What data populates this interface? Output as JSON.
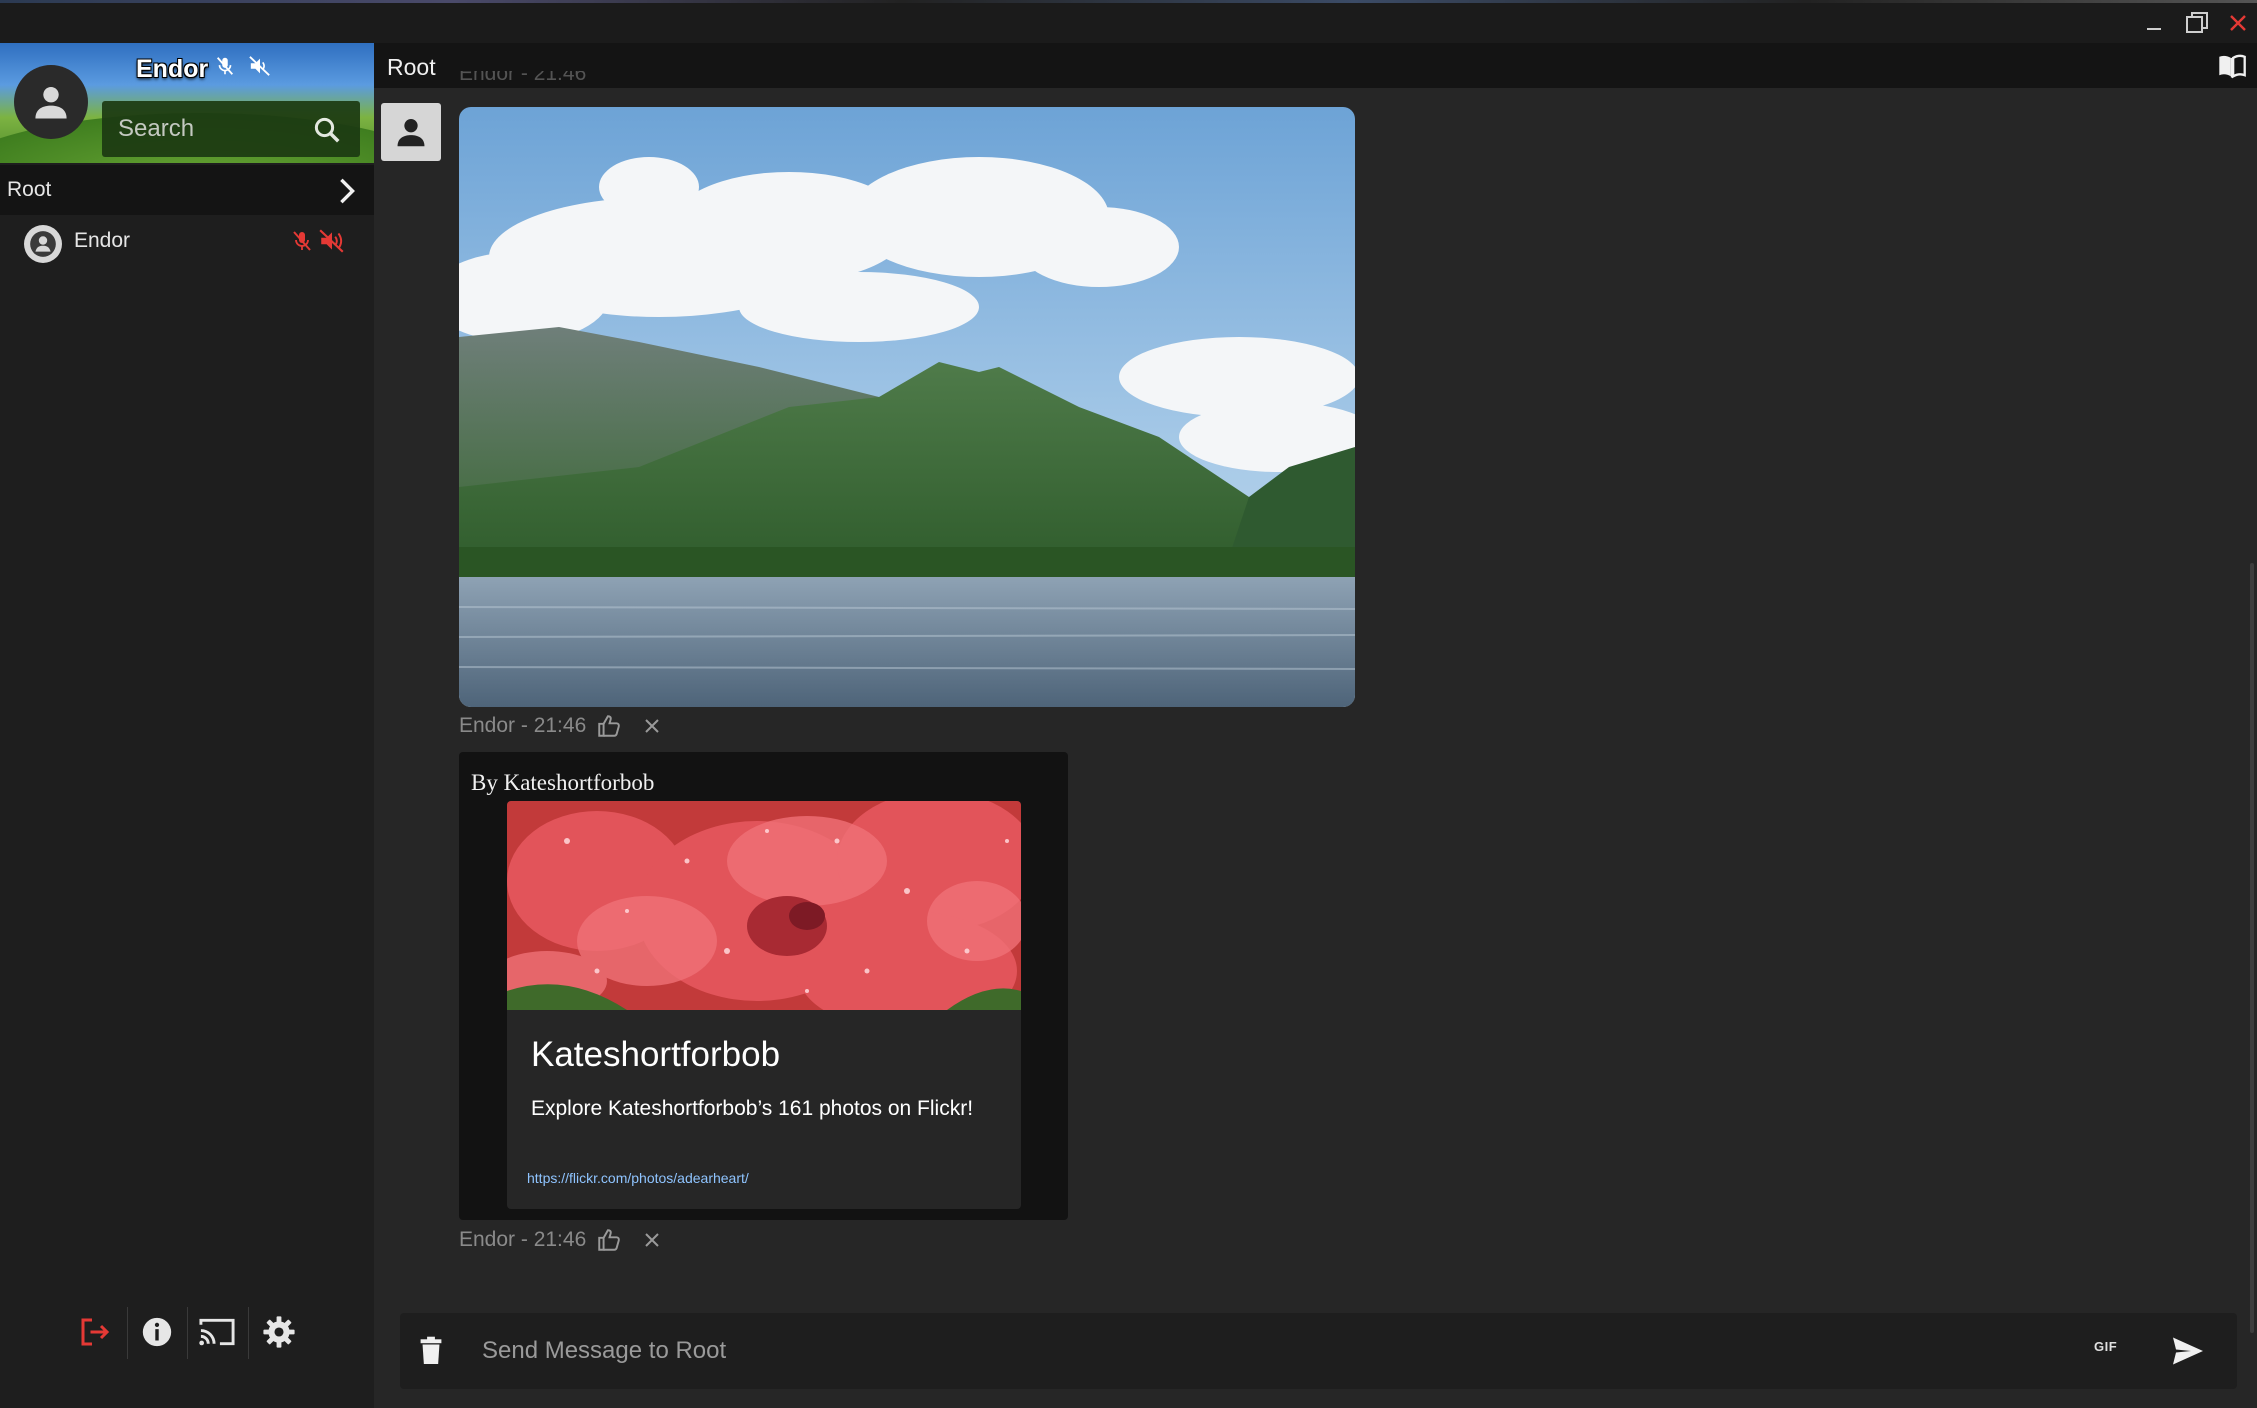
{
  "window": {
    "controls": [
      "minimize-icon",
      "maximize-icon",
      "close-icon"
    ],
    "close_color": "#e53935"
  },
  "profile": {
    "name": "Endor",
    "search_placeholder": "Search"
  },
  "channel_tree": {
    "channel_name": "Root",
    "users": [
      {
        "name": "Endor",
        "muted": true,
        "deafened": true
      }
    ]
  },
  "main": {
    "channel_title": "Root",
    "messages": [
      {
        "type": "image",
        "meta": "Endor - 21:46"
      },
      {
        "type": "embed",
        "by": "By Kateshortforbob",
        "title": "Kateshortforbob",
        "description": "Explore Kateshortforbob’s 161 photos on Flickr!",
        "link": "https://flickr.com/photos/adearheart/",
        "meta": "Endor - 21:46"
      }
    ]
  },
  "composer": {
    "placeholder": "Send Message to Root",
    "gif_label": "GIF"
  },
  "colors": {
    "accent_red": "#e53935",
    "link_blue": "#8fc4ff",
    "background": "#262626",
    "sidebar": "#1e1e1e"
  }
}
